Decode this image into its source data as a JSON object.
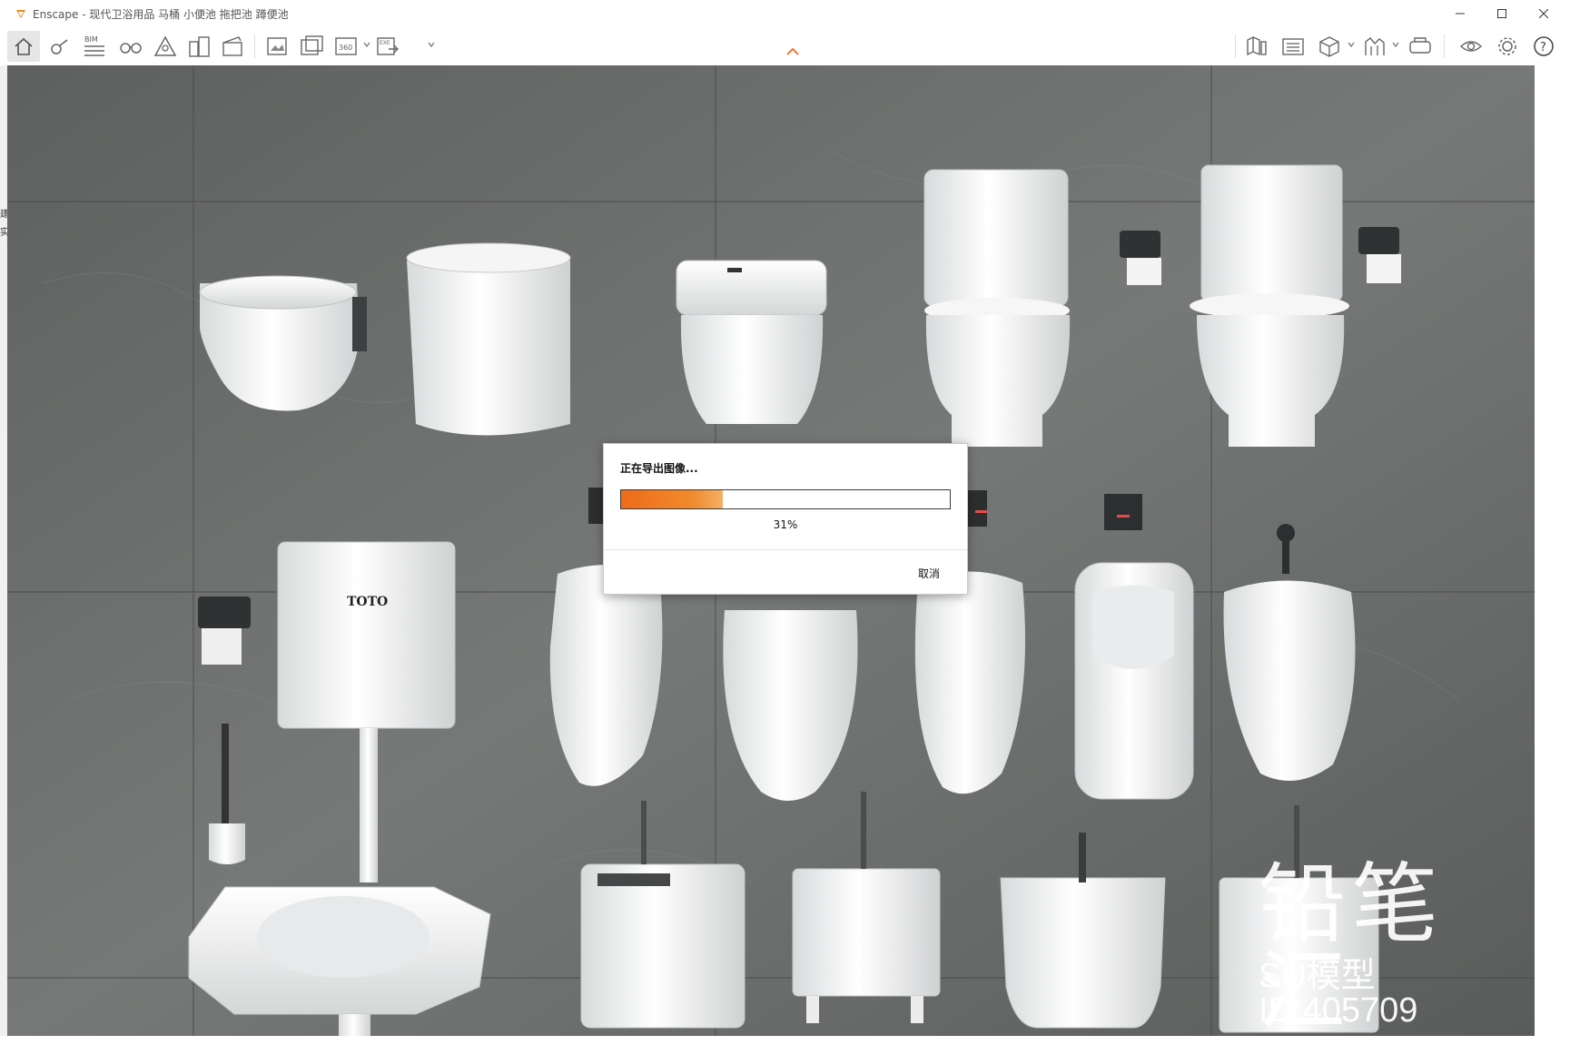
{
  "window": {
    "app_name": "Enscape",
    "title": "Enscape - 现代卫浴用品 马桶 小便池 拖把池 蹲便池"
  },
  "toolbar": {
    "bim_label": "BIM",
    "icons": [
      "home-icon",
      "compass-icon",
      "bim-list-icon",
      "binoculars-icon",
      "perspective-icon",
      "buildings-icon",
      "clapperboard-icon",
      "render-image-icon",
      "batch-render-icon",
      "panorama-360-icon",
      "export-exe-icon",
      "asset-library-icon",
      "material-editor-icon",
      "cube-view-icon",
      "chart-icon",
      "vr-headset-icon",
      "visual-settings-icon",
      "settings-gear-icon",
      "help-icon"
    ]
  },
  "left_edge_fragments": [
    "建",
    "实"
  ],
  "dialog": {
    "title": "正在导出图像...",
    "progress_percent": 31,
    "progress_text": "31%",
    "cancel_label": "取消"
  },
  "scene": {
    "tank_brand": "TOTO"
  },
  "watermark": {
    "brand": "铅笔汇",
    "model_id": "SU模型ID:405709"
  },
  "colors": {
    "accent_orange": "#ef6b1a",
    "stone_wall": "#6b6d6c",
    "porcelain": "#f4f4f4"
  }
}
